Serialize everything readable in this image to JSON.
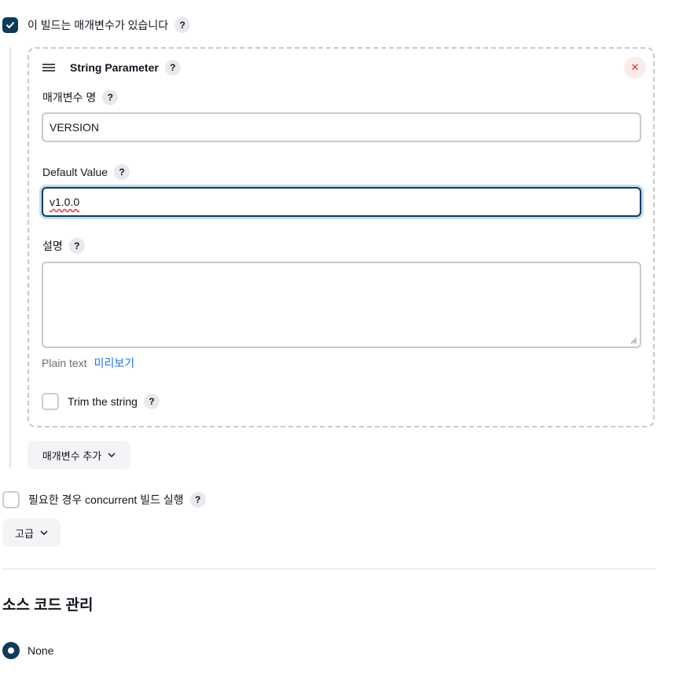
{
  "build_params": {
    "label": "이 빌드는 매개변수가 있습니다",
    "checked": true
  },
  "string_param": {
    "title": "String Parameter",
    "name": {
      "label": "매개변수 명",
      "value": "VERSION"
    },
    "default_value": {
      "label": "Default Value",
      "value": "v1.0.0"
    },
    "description": {
      "label": "설명",
      "value": ""
    },
    "format": {
      "current": "Plain text",
      "preview_link": "미리보기"
    },
    "trim": {
      "label": "Trim the string",
      "checked": false
    }
  },
  "add_param_button": "매개변수 추가",
  "concurrent": {
    "label": "필요한 경우 concurrent 빌드 실행",
    "checked": false
  },
  "advanced_button": "고급",
  "scm": {
    "heading": "소스 코드 관리",
    "options": [
      {
        "label": "None",
        "selected": true
      }
    ]
  },
  "help_glyph": "?",
  "close_glyph": "✕",
  "colors": {
    "accent": "#0e3a5c",
    "link": "#1a73e8",
    "danger": "#e63030",
    "chip_bg": "#f4f4f6"
  }
}
